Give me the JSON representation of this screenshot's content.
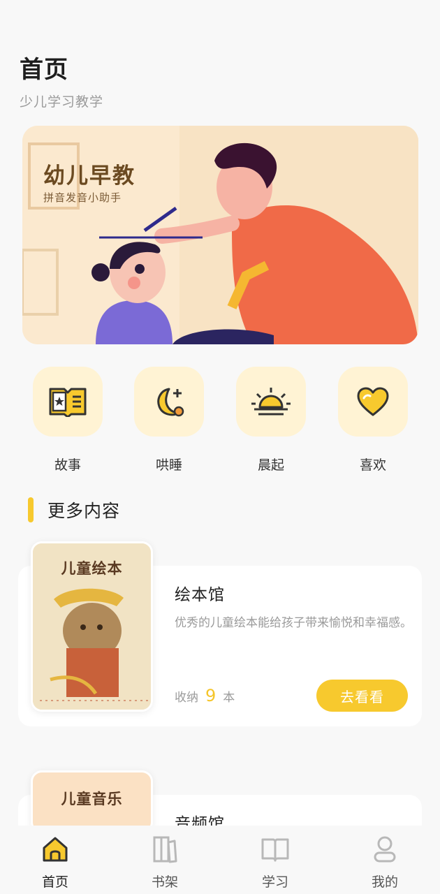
{
  "header": {
    "title": "首页",
    "subtitle": "少儿学习教学"
  },
  "banner": {
    "title": "幼儿早教",
    "subtitle": "拼音发音小助手"
  },
  "quick_actions": [
    {
      "label": "故事",
      "icon": "story-book-icon"
    },
    {
      "label": "哄睡",
      "icon": "moon-star-icon"
    },
    {
      "label": "晨起",
      "icon": "sunrise-icon"
    },
    {
      "label": "喜欢",
      "icon": "heart-icon"
    }
  ],
  "section": {
    "title": "更多内容"
  },
  "cards": [
    {
      "cover_label": "儿童绘本",
      "title": "绘本馆",
      "description": "优秀的儿童绘本能给孩子带来愉悦和幸福感。",
      "count_prefix": "收纳",
      "count": "9",
      "count_suffix": "本",
      "button": "去看看"
    },
    {
      "cover_label": "儿童音乐",
      "title": "音频馆"
    }
  ],
  "tabbar": {
    "items": [
      {
        "label": "首页",
        "icon": "home-icon",
        "active": true
      },
      {
        "label": "书架",
        "icon": "bookshelf-icon",
        "active": false
      },
      {
        "label": "学习",
        "icon": "open-book-icon",
        "active": false
      },
      {
        "label": "我的",
        "icon": "user-icon",
        "active": false
      }
    ]
  },
  "colors": {
    "accent": "#f7c92e",
    "icon_bg": "#fff3d4",
    "stroke": "#3a3a3a"
  }
}
